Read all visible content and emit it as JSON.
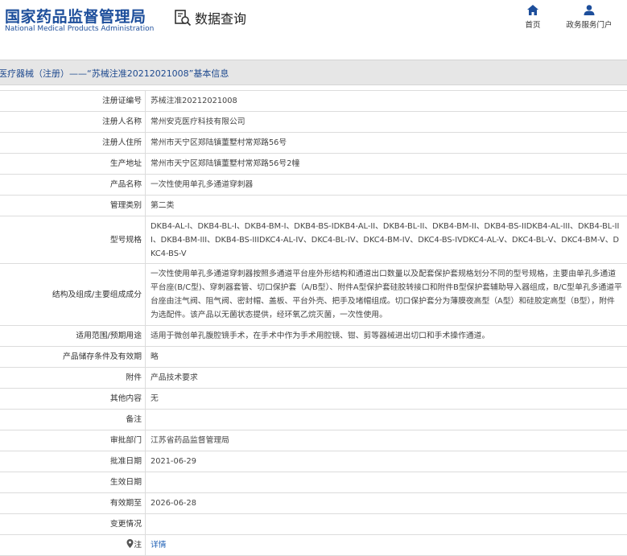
{
  "header": {
    "logo_cn": "国家药品监督管理局",
    "logo_en": "National Medical Products Administration",
    "data_query": "数据查询",
    "nav_home": "首页",
    "nav_services": "政务服务门户"
  },
  "breadcrumb": "医疗器械（注册）——“苏械注准20212021008”基本信息",
  "rows": [
    {
      "label": "注册证编号",
      "value": "苏械注准20212021008"
    },
    {
      "label": "注册人名称",
      "value": "常州安克医疗科技有限公司"
    },
    {
      "label": "注册人住所",
      "value": "常州市天宁区郑陆镇董墅村常郑路56号"
    },
    {
      "label": "生产地址",
      "value": "常州市天宁区郑陆镇董墅村常郑路56号2幢"
    },
    {
      "label": "产品名称",
      "value": "一次性使用单孔多通道穿刺器"
    },
    {
      "label": "管理类别",
      "value": "第二类"
    },
    {
      "label": "型号规格",
      "value": "DKB4-AL-I、DKB4-BL-I、DKB4-BM-I、DKB4-BS-IDKB4-AL-II、DKB4-BL-II、DKB4-BM-II、DKB4-BS-IIDKB4-AL-III、DKB4-BL-III、DKB4-BM-III、DKB4-BS-IIIDKC4-AL-IV、DKC4-BL-IV、DKC4-BM-IV、DKC4-BS-IVDKC4-AL-V、DKC4-BL-V、DKC4-BM-V、DKC4-BS-V"
    },
    {
      "label": "结构及组成/主要组成成分",
      "value": "一次性使用单孔多通道穿刺器按照多通道平台座外形结构和通道出口数量以及配套保护套规格划分不同的型号规格，主要由单孔多通道平台座(B/C型)、穿刺器套管、切口保护套（A/B型）、附件A型保护套硅胶转接口和附件B型保护套辅助导入器组成，B/C型单孔多通道平台座由注气阀、阻气阀、密封帽、盖板、平台外壳、把手及堵帽组成。切口保护套分为薄膜夜高型（A型）和硅胶定高型（B型），附件为选配件。该产品以无菌状态提供，经环氧乙烷灭菌，一次性使用。"
    },
    {
      "label": "适用范围/预期用途",
      "value": "适用于微创单孔腹腔镜手术，在手术中作为手术用腔镜、钳、剪等器械进出切口和手术操作通道。"
    },
    {
      "label": "产品储存条件及有效期",
      "value": "略"
    },
    {
      "label": "附件",
      "value": "产品技术要求"
    },
    {
      "label": "其他内容",
      "value": "无"
    },
    {
      "label": "备注",
      "value": ""
    },
    {
      "label": "审批部门",
      "value": "江苏省药品监督管理局"
    },
    {
      "label": "批准日期",
      "value": "2021-06-29"
    },
    {
      "label": "生效日期",
      "value": ""
    },
    {
      "label": "有效期至",
      "value": "2026-06-28"
    },
    {
      "label": "变更情况",
      "value": ""
    }
  ],
  "note": {
    "label": "注",
    "value": "详情"
  }
}
